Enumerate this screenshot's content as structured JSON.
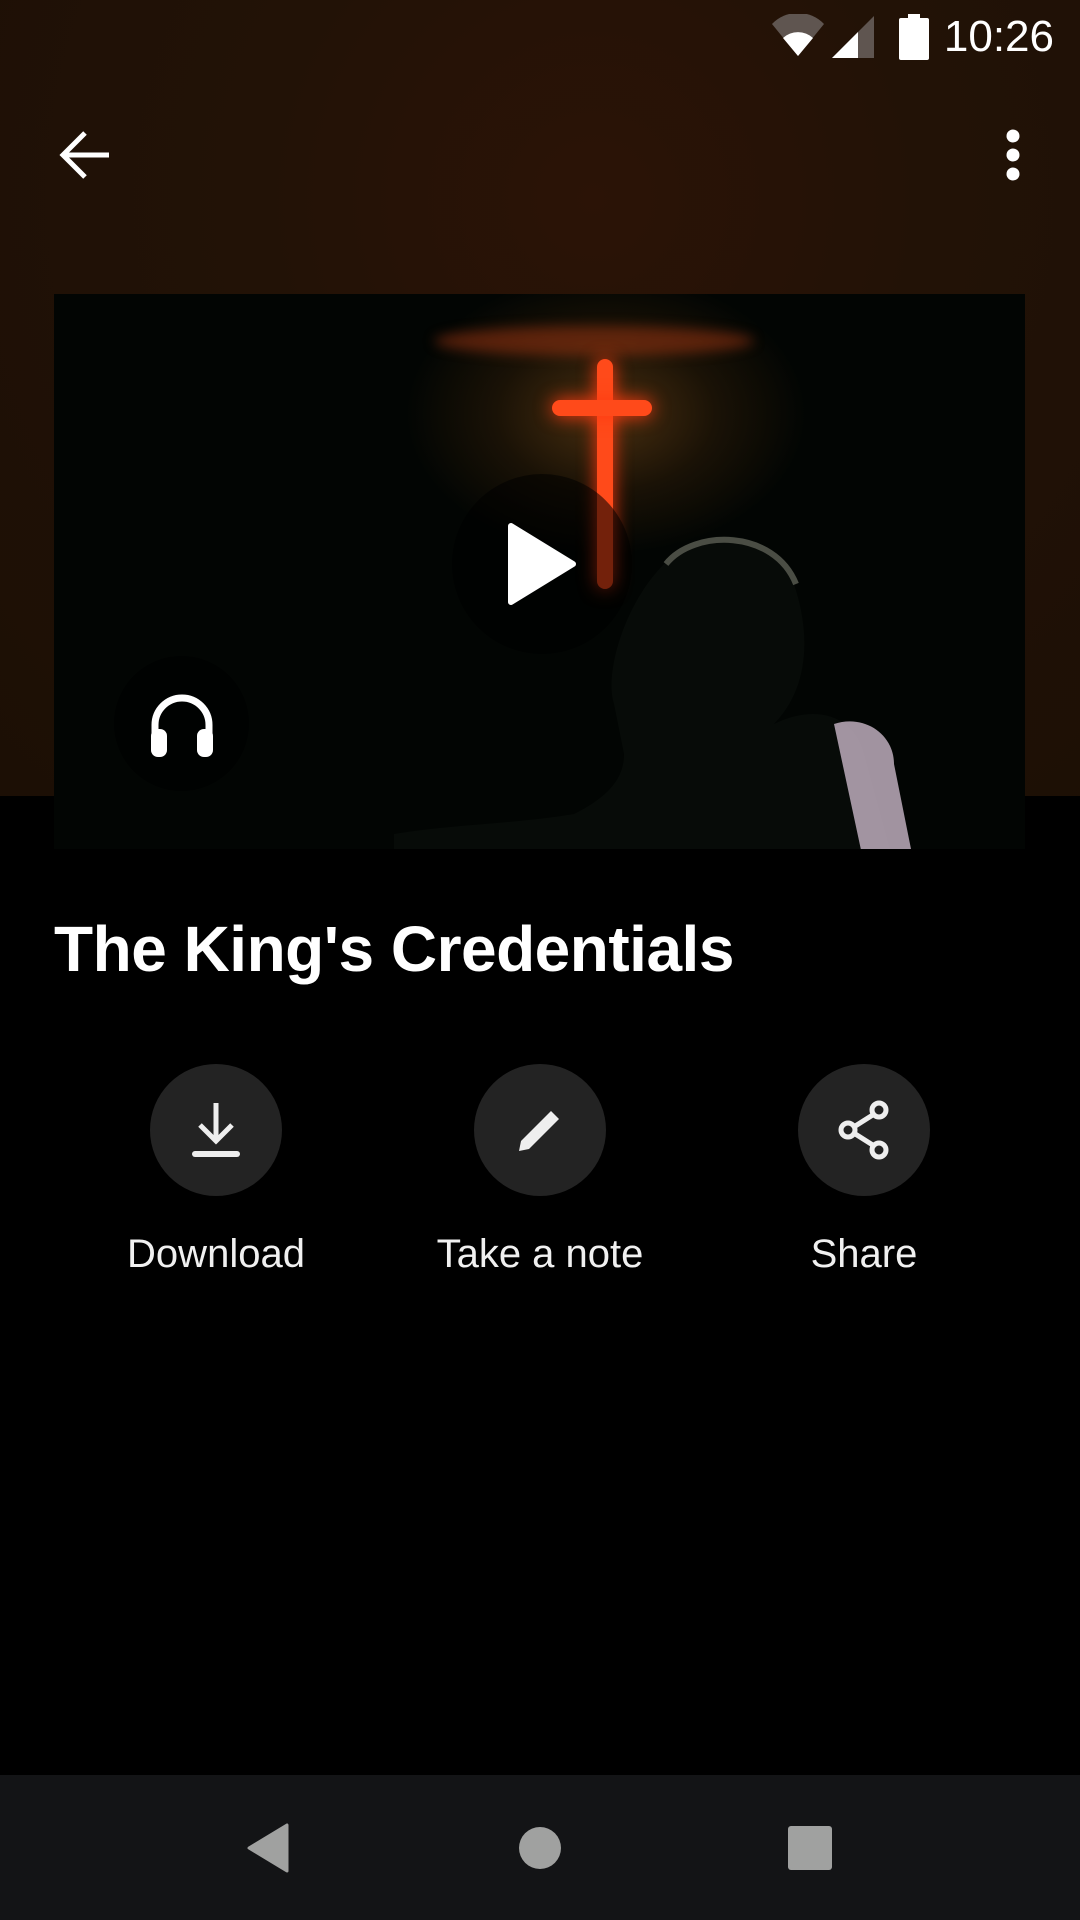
{
  "status_bar": {
    "time": "10:26",
    "icons": [
      "wifi-icon",
      "cellular-signal-icon",
      "battery-icon"
    ]
  },
  "toolbar": {
    "back_icon": "arrow-left-icon",
    "more_icon": "more-vertical-icon"
  },
  "media": {
    "play_icon": "play-icon",
    "audio_icon": "headphones-icon",
    "accent_color": "#ff4a1a"
  },
  "content": {
    "title": "The King's Credentials"
  },
  "actions": [
    {
      "label": "Download",
      "icon": "download-icon"
    },
    {
      "label": "Take a note",
      "icon": "pencil-icon"
    },
    {
      "label": "Share",
      "icon": "share-icon"
    }
  ],
  "nav_bar": {
    "buttons": [
      "back-triangle-icon",
      "home-circle-icon",
      "recents-square-icon"
    ]
  }
}
